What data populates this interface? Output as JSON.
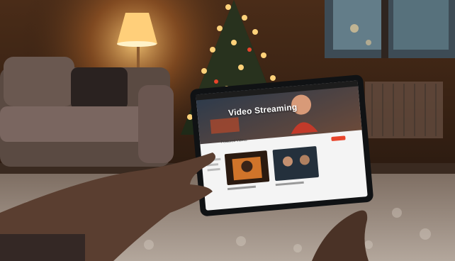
{
  "tablet": {
    "hero_title": "Video Streaming",
    "section_title": "Featured Videos",
    "cards": [
      {
        "caption": ""
      },
      {
        "caption": ""
      }
    ]
  },
  "colors": {
    "warm_light": "#ffb347",
    "room_dark": "#1a120c",
    "accent": "#e8452c"
  }
}
